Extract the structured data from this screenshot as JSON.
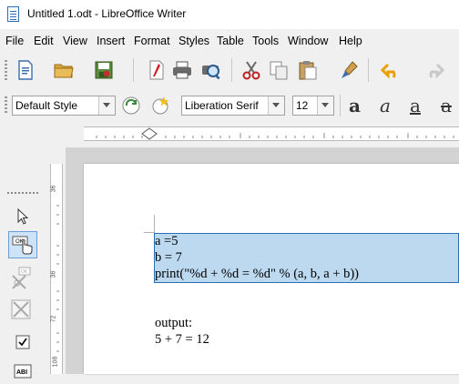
{
  "window": {
    "title": "Untitled 1.odt - LibreOffice Writer"
  },
  "menu": [
    "File",
    "Edit",
    "View",
    "Insert",
    "Format",
    "Styles",
    "Table",
    "Tools",
    "Window",
    "Help"
  ],
  "toolbar": {
    "icons": [
      "new-document-icon",
      "open-folder-icon",
      "save-icon",
      "export-pdf-icon",
      "print-icon",
      "print-preview-icon",
      "cut-icon",
      "copy-icon",
      "paste-icon",
      "clone-formatting-icon",
      "undo-icon",
      "redo-icon"
    ]
  },
  "formatting": {
    "paragraph_style": "Default Style",
    "font_name": "Liberation Serif",
    "font_size": "12",
    "bold_glyph": "a",
    "italic_glyph": "a",
    "underline_glyph": "a",
    "strike_glyph": "a"
  },
  "vertical_ruler": {
    "labels": [
      "36",
      "36",
      "72",
      "108"
    ]
  },
  "sidebar": {
    "icons": [
      "select-arrow-icon",
      "push-button-icon",
      "push-button-disabled-icon",
      "design-mode-icon",
      "checkbox-icon",
      "label-field-icon"
    ]
  },
  "document": {
    "lines": [
      "a =5",
      "b = 7",
      "print(\"%d + %d = %d\" % (a, b, a + b))",
      "output:",
      "5 + 7 = 12"
    ]
  },
  "colors": {
    "selection": "#bcd9f0",
    "selection_border": "#2a6fb8",
    "accent_undo": "#e8a000"
  }
}
